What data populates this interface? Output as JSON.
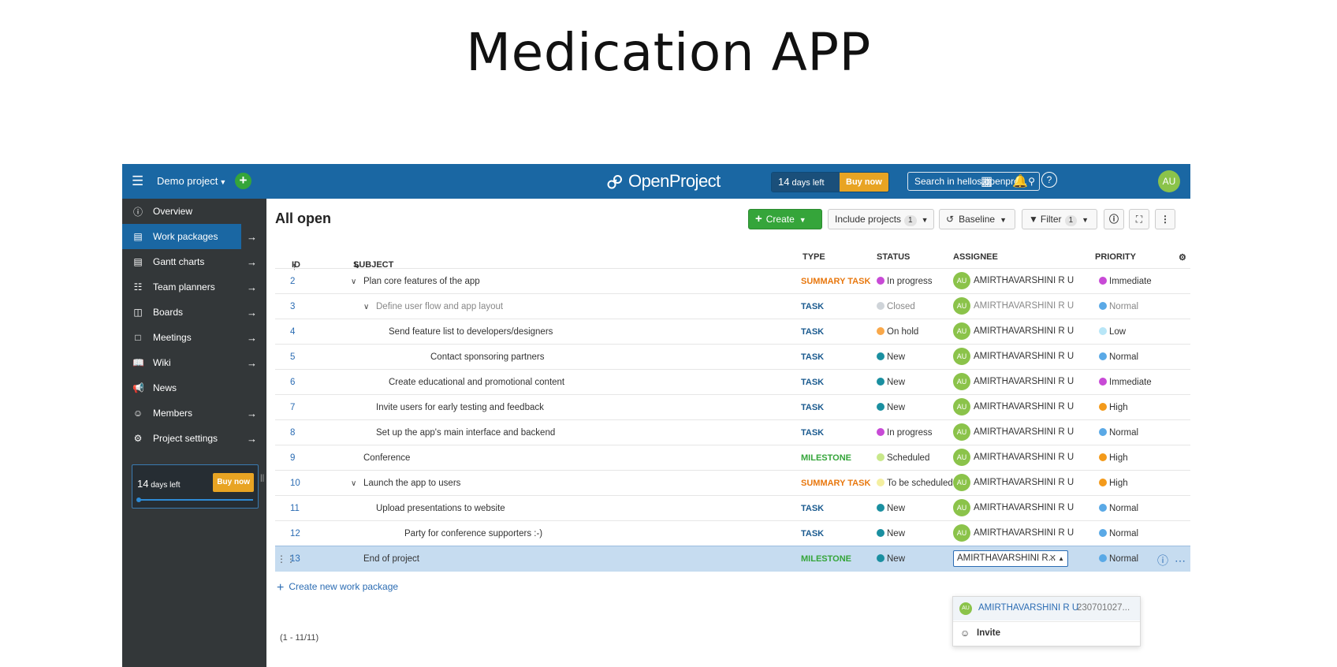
{
  "slide": {
    "title": "Medication APP"
  },
  "topbar": {
    "project": "Demo project",
    "logo": "OpenProject",
    "trial_days_num": "14",
    "trial_days_text": "days left",
    "buy_now": "Buy now",
    "search_placeholder": "Search in hellos.openpro...",
    "avatar": "AU"
  },
  "sidebar": {
    "items": [
      {
        "label": "Overview",
        "icon": "info-icon"
      },
      {
        "label": "Work packages",
        "icon": "work-packages-icon"
      },
      {
        "label": "Gantt charts",
        "icon": "gantt-icon"
      },
      {
        "label": "Team planners",
        "icon": "team-planner-icon"
      },
      {
        "label": "Boards",
        "icon": "boards-icon"
      },
      {
        "label": "Meetings",
        "icon": "meetings-icon"
      },
      {
        "label": "Wiki",
        "icon": "wiki-icon"
      },
      {
        "label": "News",
        "icon": "news-icon"
      },
      {
        "label": "Members",
        "icon": "members-icon"
      },
      {
        "label": "Project settings",
        "icon": "settings-icon"
      }
    ],
    "trial_days_num": "14",
    "trial_days_text": "days left",
    "buy_now": "Buy now"
  },
  "main": {
    "title": "All open",
    "toolbar": {
      "create": "Create",
      "include_projects": "Include projects",
      "include_projects_count": "1",
      "baseline": "Baseline",
      "filter": "Filter",
      "filter_count": "1"
    },
    "columns": {
      "id": "ID",
      "subject": "SUBJECT",
      "type": "TYPE",
      "status": "STATUS",
      "assignee": "ASSIGNEE",
      "priority": "PRIORITY"
    },
    "rows": [
      {
        "id": "2",
        "subject": "Plan core features of the app",
        "type": "SUMMARY TASK",
        "status": "In progress",
        "assignee": "AMIRTHAVARSHINI R U",
        "priority": "Immediate"
      },
      {
        "id": "3",
        "subject": "Define user flow and app layout",
        "type": "TASK",
        "status": "Closed",
        "assignee": "AMIRTHAVARSHINI R U",
        "priority": "Normal"
      },
      {
        "id": "4",
        "subject": "Send feature list to developers/designers",
        "type": "TASK",
        "status": "On hold",
        "assignee": "AMIRTHAVARSHINI R U",
        "priority": "Low"
      },
      {
        "id": "5",
        "subject": "Contact sponsoring partners",
        "type": "TASK",
        "status": "New",
        "assignee": "AMIRTHAVARSHINI R U",
        "priority": "Normal"
      },
      {
        "id": "6",
        "subject": "Create educational and promotional content",
        "type": "TASK",
        "status": "New",
        "assignee": "AMIRTHAVARSHINI R U",
        "priority": "Immediate"
      },
      {
        "id": "7",
        "subject": "Invite users for early testing and feedback",
        "type": "TASK",
        "status": "New",
        "assignee": "AMIRTHAVARSHINI R U",
        "priority": "High"
      },
      {
        "id": "8",
        "subject": "Set up the app's main interface and backend",
        "type": "TASK",
        "status": "In progress",
        "assignee": "AMIRTHAVARSHINI R U",
        "priority": "Normal"
      },
      {
        "id": "9",
        "subject": "Conference",
        "type": "MILESTONE",
        "status": "Scheduled",
        "assignee": "AMIRTHAVARSHINI R U",
        "priority": "High"
      },
      {
        "id": "10",
        "subject": "Launch the app to users",
        "type": "SUMMARY TASK",
        "status": "To be scheduled",
        "assignee": "AMIRTHAVARSHINI R U",
        "priority": "High"
      },
      {
        "id": "11",
        "subject": "Upload presentations to website",
        "type": "TASK",
        "status": "New",
        "assignee": "AMIRTHAVARSHINI R U",
        "priority": "Normal"
      },
      {
        "id": "12",
        "subject": "Party for conference supporters :-)",
        "type": "TASK",
        "status": "New",
        "assignee": "AMIRTHAVARSHINI R U",
        "priority": "Normal"
      },
      {
        "id": "13",
        "subject": "End of project",
        "type": "MILESTONE",
        "status": "New",
        "assignee": "AMIRTHAVARSHINI R...",
        "priority": "Normal"
      }
    ],
    "assignee_dropdown": {
      "option_name": "AMIRTHAVARSHINI R U",
      "option_code": "230701027...",
      "invite": "Invite"
    },
    "create_new": "Create new work package",
    "pagination": "(1 - 11/11)"
  },
  "colors": {
    "topbar": "#1a67a3",
    "sidebar": "#333739",
    "type_summary": "#e8780f",
    "type_task": "#1a5a8f",
    "type_milestone": "#35a53a",
    "status_in_progress": "#c84ad6",
    "status_closed": "#cfd4d9",
    "status_on_hold": "#f9a84a",
    "status_new": "#1a8fa0",
    "status_scheduled": "#c8e88a",
    "status_to_be_scheduled": "#f4efa0",
    "prio_immediate": "#c84ad6",
    "prio_normal": "#5aa9e6",
    "prio_low": "#b8e6f7",
    "prio_high": "#f39a1b"
  }
}
